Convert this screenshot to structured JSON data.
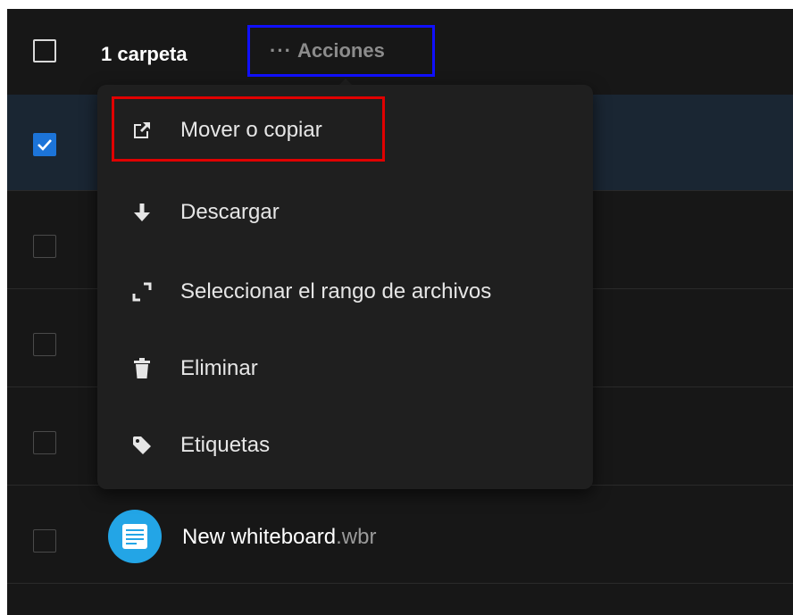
{
  "header": {
    "selection_count": "1 carpeta",
    "actions_dots": "···",
    "actions_label": "Acciones"
  },
  "menu": {
    "items": [
      {
        "label": "Mover o copiar",
        "icon": "move-copy-icon"
      },
      {
        "label": "Descargar",
        "icon": "download-icon"
      },
      {
        "label": "Seleccionar el rango de archivos",
        "icon": "select-range-icon"
      },
      {
        "label": "Eliminar",
        "icon": "trash-icon"
      },
      {
        "label": "Etiquetas",
        "icon": "tag-icon"
      }
    ]
  },
  "files": [
    {
      "name": "New whiteboard",
      "ext": ".wbr",
      "icon": "whiteboard-icon"
    }
  ],
  "colors": {
    "background": "#171717",
    "menu_background": "#1f1f1f",
    "checkbox_checked": "#1c74d9",
    "selected_row": "#1a2633",
    "whiteboard_icon": "#23a5e6",
    "annotation_blue": "#1010ff",
    "annotation_red": "#e00000"
  }
}
